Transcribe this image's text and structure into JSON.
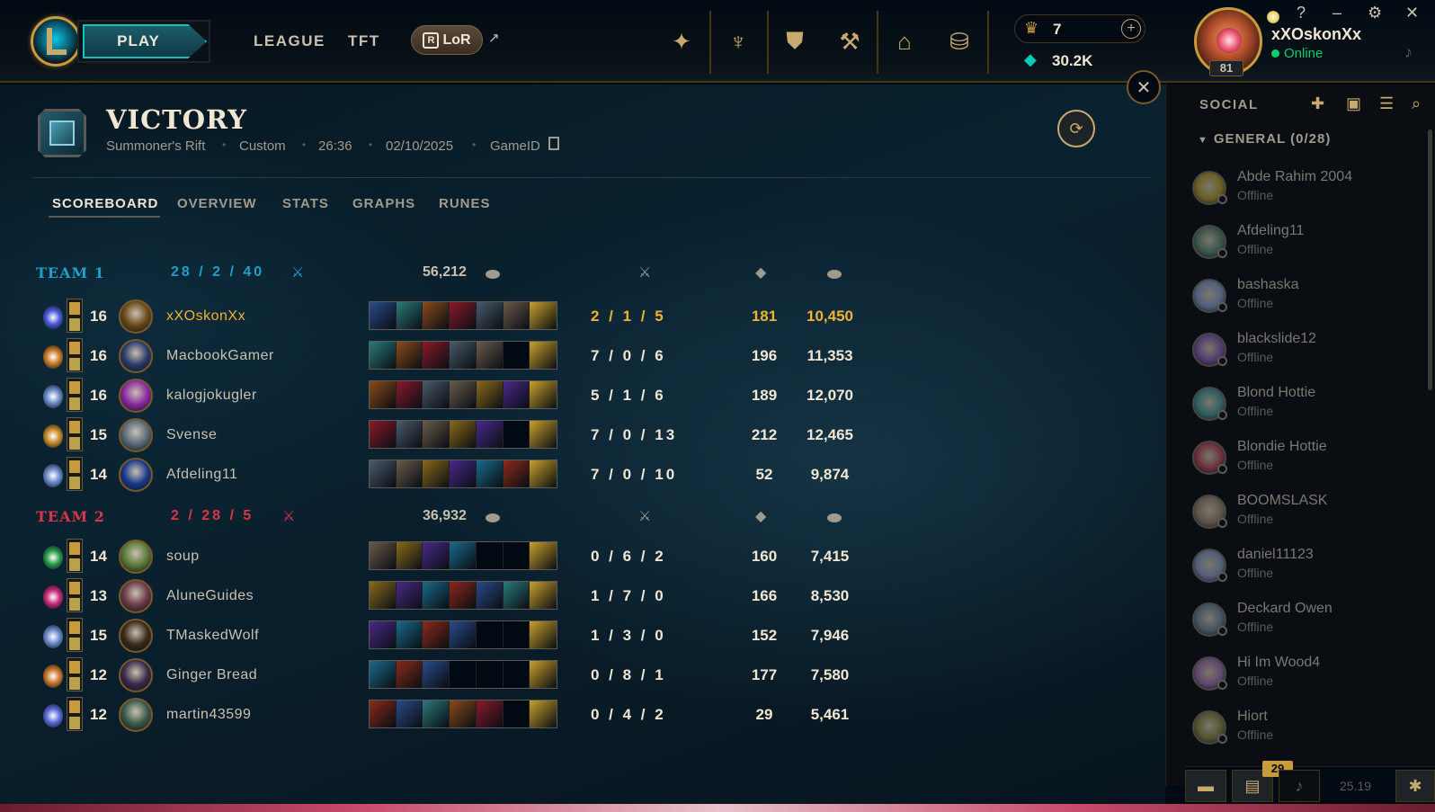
{
  "nav": {
    "play": "PLAY",
    "league": "LEAGUE",
    "tft": "TFT",
    "lor_badge": "R",
    "lor": "LoR",
    "external_arrow": "↗"
  },
  "wallet": {
    "rp": "7",
    "plus": "+",
    "blue_essence": "30.2K"
  },
  "profile": {
    "username": "xXOskonXx",
    "status": "Online",
    "level": "81"
  },
  "window_controls": [
    "?",
    "–",
    "⚙",
    "✕"
  ],
  "match": {
    "result": "VICTORY",
    "map": "Summoner's Rift",
    "mode": "Custom",
    "duration": "26:36",
    "date": "02/10/2025",
    "game_id_label": "GameID"
  },
  "tabs": [
    "SCOREBOARD",
    "OVERVIEW",
    "STATS",
    "GRAPHS",
    "RUNES"
  ],
  "team1": {
    "name": "TEAM 1",
    "kda": "28 / 2 / 40",
    "gold": "56,212",
    "color": "#1ea0c8",
    "players": [
      {
        "level": "16",
        "name": "xXOskonXx",
        "kda": "2 / 1 / 5",
        "cs": "181",
        "gold": "10,450"
      },
      {
        "level": "16",
        "name": "MacbookGamer",
        "kda": "7 / 0 / 6",
        "cs": "196",
        "gold": "11,353"
      },
      {
        "level": "16",
        "name": "kalogjokugler",
        "kda": "5 / 1 / 6",
        "cs": "189",
        "gold": "12,070"
      },
      {
        "level": "15",
        "name": "Svense",
        "kda": "7 / 0 / 13",
        "cs": "212",
        "gold": "12,465"
      },
      {
        "level": "14",
        "name": "Afdeling11",
        "kda": "7 / 0 / 10",
        "cs": "52",
        "gold": "9,874"
      }
    ]
  },
  "team2": {
    "name": "TEAM 2",
    "kda": "2 / 28 / 5",
    "gold": "36,932",
    "color": "#d8364a",
    "players": [
      {
        "level": "14",
        "name": "soup",
        "kda": "0 / 6 / 2",
        "cs": "160",
        "gold": "7,415"
      },
      {
        "level": "13",
        "name": "AluneGuides",
        "kda": "1 / 7 / 0",
        "cs": "166",
        "gold": "8,530"
      },
      {
        "level": "15",
        "name": "TMaskedWolf",
        "kda": "1 / 3 / 0",
        "cs": "152",
        "gold": "7,946"
      },
      {
        "level": "12",
        "name": "Ginger Bread",
        "kda": "0 / 8 / 1",
        "cs": "177",
        "gold": "7,580"
      },
      {
        "level": "12",
        "name": "martin43599",
        "kda": "0 / 4 / 2",
        "cs": "29",
        "gold": "5,461"
      }
    ]
  },
  "social": {
    "title": "SOCIAL",
    "group": "GENERAL (0/28)",
    "friends": [
      {
        "name": "Abde Rahim 2004",
        "status": "Offline"
      },
      {
        "name": "Afdeling11",
        "status": "Offline"
      },
      {
        "name": "bashaska",
        "status": "Offline"
      },
      {
        "name": "blackslide12",
        "status": "Offline"
      },
      {
        "name": "Blond Hottie",
        "status": "Offline"
      },
      {
        "name": "Blondie Hottie",
        "status": "Offline"
      },
      {
        "name": "BOOMSLASK",
        "status": "Offline"
      },
      {
        "name": "daniel11123",
        "status": "Offline"
      },
      {
        "name": "Deckard Owen",
        "status": "Offline"
      },
      {
        "name": "Hi Im Wood4",
        "status": "Offline"
      },
      {
        "name": "Hiort",
        "status": "Offline"
      }
    ]
  },
  "bottom": {
    "badge": "29",
    "version": "25.19"
  }
}
